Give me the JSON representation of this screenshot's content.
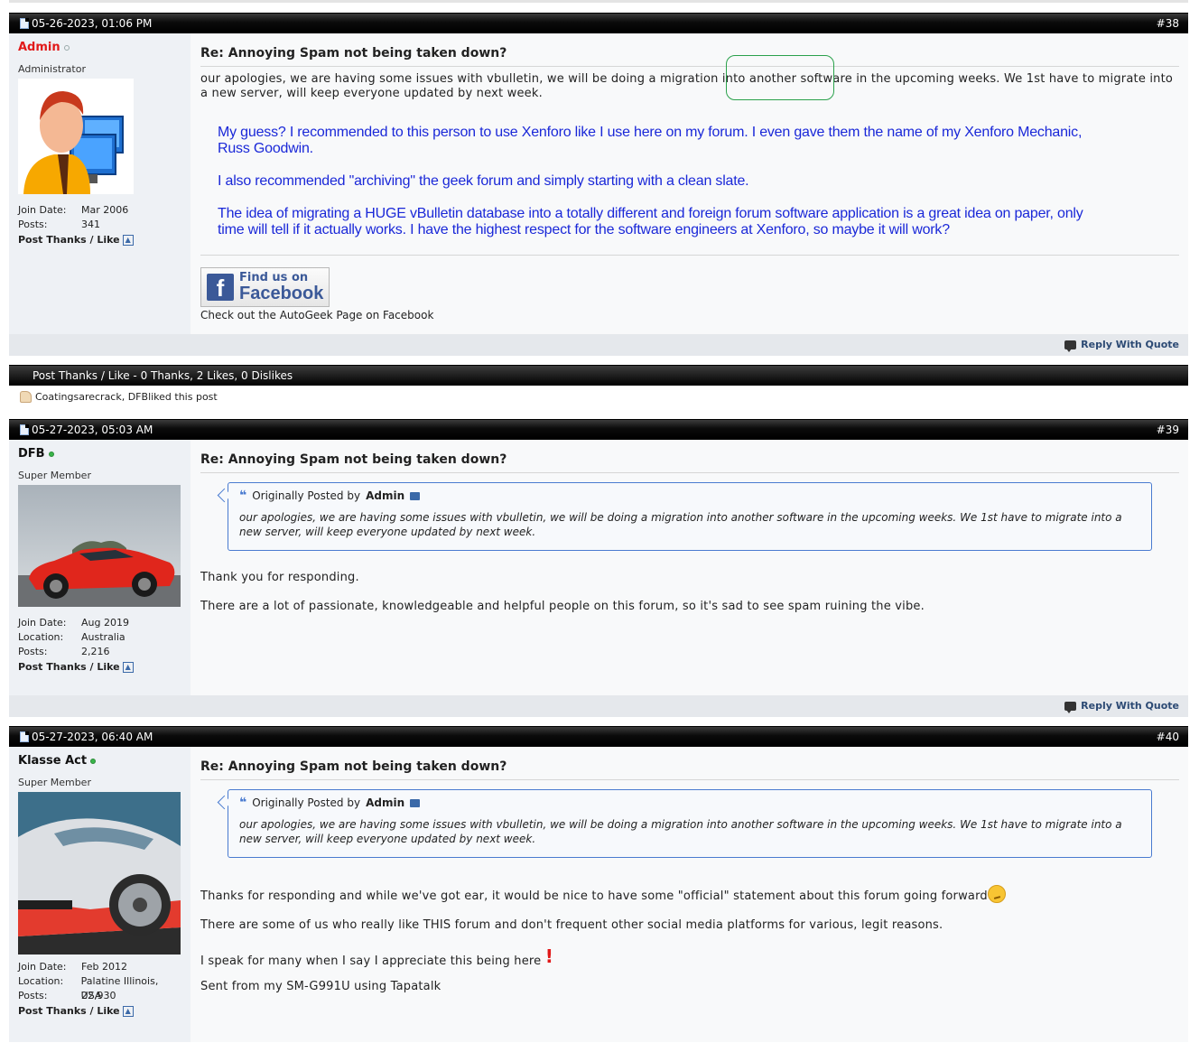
{
  "posts": [
    {
      "date": "05-26-2023, 01:06 PM",
      "number": "#38",
      "user": {
        "name": "Admin",
        "title": "Administrator",
        "join_label": "Join Date:",
        "join_date": "Mar 2006",
        "posts_label": "Posts:",
        "posts": "341"
      },
      "title": "Re: Annoying Spam not being taken down?",
      "text": "our apologies, we are having some issues with vbulletin, we will be doing a migration into another software in the upcoming weeks. We 1st have to migrate into a new server, will keep everyone updated by next week.",
      "blue_paragraphs": [
        "My guess?  I recommended to this person to use Xenforo like I use here on my forum.  I even gave them the name of my Xenforo Mechanic, Russ Goodwin.",
        "I also recommended \"archiving\" the geek forum and simply starting with a clean slate.",
        "The idea of migrating a HUGE vBulletin database into a totally different and foreign forum software application is a great idea on paper, only time will tell if it actually works.  I have the highest respect for the software engineers at Xenforo, so maybe it will work?"
      ],
      "fb_line1": "Find us on",
      "fb_line2": "Facebook",
      "fb_logo": "f",
      "fb_caption": "Check out the AutoGeek Page on Facebook"
    },
    {
      "date": "05-27-2023, 05:03 AM",
      "number": "#39",
      "user": {
        "name": "DFB",
        "title": "Super Member",
        "join_label": "Join Date:",
        "join_date": "Aug 2019",
        "location_label": "Location:",
        "location": "Australia",
        "posts_label": "Posts:",
        "posts": "2,216"
      },
      "title": "Re: Annoying Spam not being taken down?",
      "quote": {
        "prefix": "Originally Posted by",
        "author": "Admin",
        "text": "our apologies, we are having some issues with vbulletin, we will be doing a migration into another software in the upcoming weeks. We 1st have to migrate into a new server, will keep everyone updated by next week."
      },
      "paragraphs": [
        "Thank you for responding.",
        "There are a lot of passionate, knowledgeable and helpful people on this forum, so it's sad to see spam ruining the vibe."
      ]
    },
    {
      "date": "05-27-2023, 06:40 AM",
      "number": "#40",
      "user": {
        "name": "Klasse Act",
        "title": "Super Member",
        "join_label": "Join Date:",
        "join_date": "Feb 2012",
        "location_label": "Location:",
        "location": "Palatine Illinois, USA",
        "posts_label": "Posts:",
        "posts": "22,930"
      },
      "title": "Re: Annoying Spam not being taken down?",
      "quote": {
        "prefix": "Originally Posted by",
        "author": "Admin",
        "text": "our apologies, we are having some issues with vbulletin, we will be doing a migration into another software in the upcoming weeks. We 1st have to migrate into a new server, will keep everyone updated by next week."
      },
      "paragraphs": [
        "Thanks for responding and while we've got ear, it would be nice to have some \"official\" statement about this forum going forward",
        "There are some of us who really like THIS forum and don't frequent other social media platforms for various, legit reasons.",
        "I speak for many when I say I appreciate this being here",
        "Sent from my SM-G991U using Tapatalk"
      ]
    }
  ],
  "common": {
    "post_thanks_like": "Post Thanks / Like",
    "reply_with_quote": "Reply With Quote",
    "excl": "!"
  },
  "thanks_bar": {
    "text": "Post Thanks / Like - 0 Thanks, 2 Likes, 0 Dislikes",
    "likers_names": "Coatingsarecrack, DFB",
    "likers_suffix": " liked this post"
  },
  "colors": {
    "admin": "#e11919",
    "link_blue": "#1a28d8",
    "online": "#39b54a",
    "highlight": "#2aa14b",
    "quote_border": "#4a7bd0"
  },
  "icons": [
    "document-icon",
    "status-dot-icon",
    "thumbs-up-icon",
    "reply-quote-icon",
    "quote-mark-icon",
    "view-post-icon",
    "facebook-icon",
    "thinking-emoji-icon",
    "exclamation-icon"
  ]
}
